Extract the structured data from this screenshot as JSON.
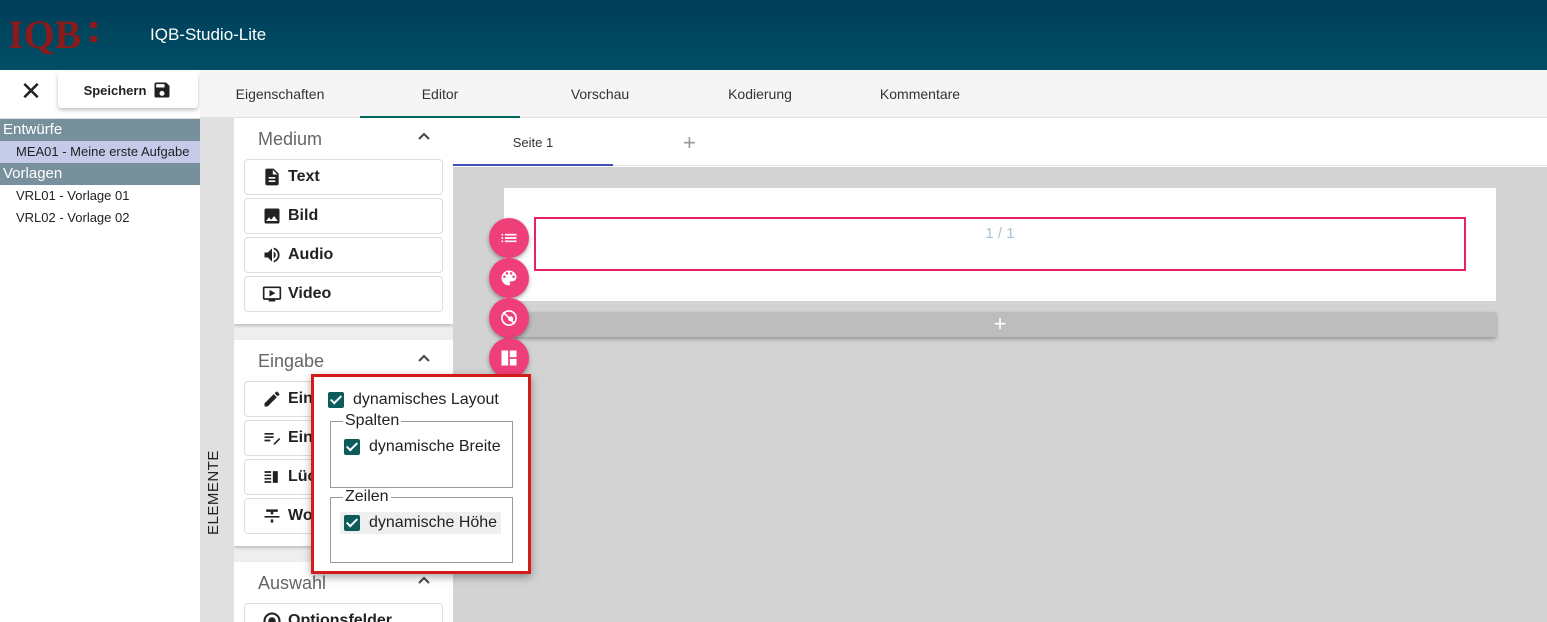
{
  "header": {
    "logo_text": "IQB",
    "app_title": "IQB-Studio-Lite"
  },
  "toolbar": {
    "close_label": "✕",
    "save_label": "Speichern"
  },
  "units": {
    "sections": [
      {
        "title": "Entwürfe",
        "items": [
          {
            "label": "MEA01 - Meine erste Aufgabe",
            "selected": true
          }
        ]
      },
      {
        "title": "Vorlagen",
        "items": [
          {
            "label": "VRL01 - Vorlage 01"
          },
          {
            "label": "VRL02 - Vorlage 02"
          }
        ]
      }
    ]
  },
  "tabs": [
    {
      "label": "Eigenschaften"
    },
    {
      "label": "Editor",
      "active": true
    },
    {
      "label": "Vorschau"
    },
    {
      "label": "Kodierung"
    },
    {
      "label": "Kommentare"
    }
  ],
  "elements_panel": {
    "title": "ELEMENTE",
    "groups": [
      {
        "title": "Medium",
        "items": [
          "Text",
          "Bild",
          "Audio",
          "Video"
        ]
      },
      {
        "title": "Eingabe",
        "items": [
          "Ein",
          "Ein",
          "Lüc",
          "Wo"
        ]
      },
      {
        "title": "Auswahl",
        "items": [
          "Optionsfelder"
        ]
      }
    ]
  },
  "page_tabs": {
    "tab_label": "Seite 1",
    "add_label": "+"
  },
  "section": {
    "counter": "1 / 1",
    "add_label": "+"
  },
  "layout_popup": {
    "dynamic_layout_label": "dynamisches Layout",
    "columns_legend": "Spalten",
    "dynamic_width_label": "dynamische Breite",
    "rows_legend": "Zeilen",
    "dynamic_height_label": "dynamische Höhe",
    "dynamic_layout_checked": true,
    "dynamic_width_checked": true,
    "dynamic_height_checked": true
  },
  "colors": {
    "header": "#004f66",
    "accent_pink": "#ef3f78",
    "section_border": "#e91e63",
    "checkbox": "#0d5c5c",
    "highlight_border": "#d41b1b"
  }
}
